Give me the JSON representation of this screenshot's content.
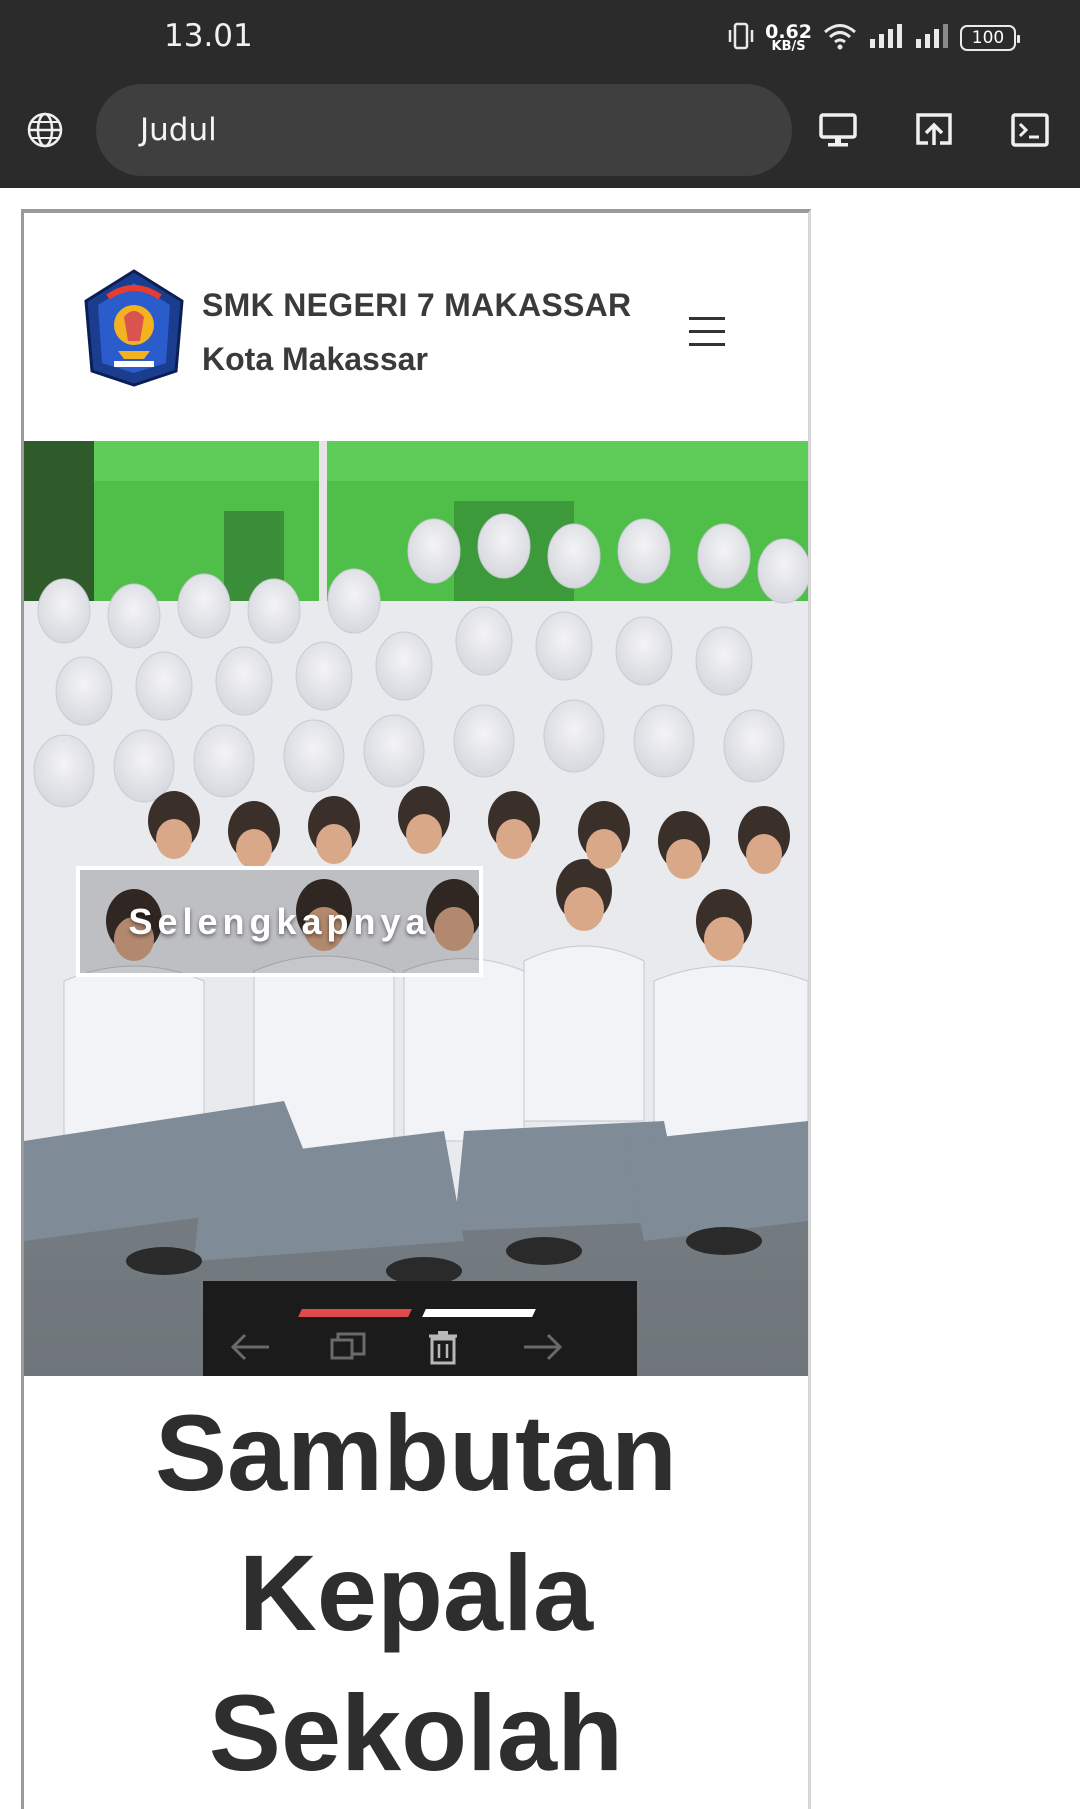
{
  "status_bar": {
    "time": "13.01",
    "net_speed_value": "0.62",
    "net_speed_unit": "KB/S",
    "battery": "100",
    "icons": [
      "vibrate-icon",
      "wifi-icon",
      "signal-icon",
      "signal-icon",
      "battery-icon"
    ]
  },
  "browser": {
    "url_text": "Judul",
    "left_icon": "globe-icon",
    "right_icons": [
      "desktop-icon",
      "share-upload-icon",
      "terminal-icon"
    ]
  },
  "site": {
    "school_name": "SMK NEGERI 7 MAKASSAR",
    "city": "Kota Makassar",
    "menu_icon": "hamburger-icon"
  },
  "hero": {
    "cta_label": "Selengkapnya",
    "slider_dot_colors": [
      "#e04a4a",
      "#ffffff"
    ],
    "controls": [
      "arrow-left-icon",
      "slideshow-icon",
      "trash-icon",
      "arrow-right-icon"
    ]
  },
  "section": {
    "title_lines": [
      "Sambutan",
      "Kepala",
      "Sekolah"
    ]
  },
  "colors": {
    "chrome_bg": "#2b2b2b",
    "url_bar_bg": "#3f3f3f",
    "building_green": "#4fbf4a",
    "accent_red": "#e04a4a"
  }
}
